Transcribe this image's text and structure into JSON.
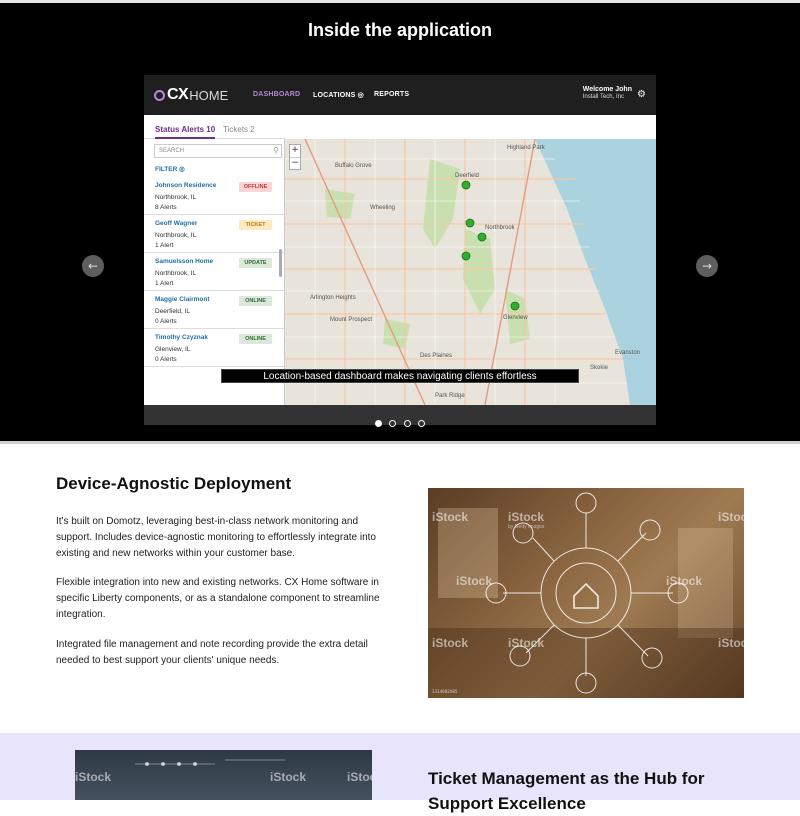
{
  "hero": {
    "title": "Inside the application",
    "caption": "Location-based dashboard makes navigating clients effortless",
    "prev_icon": "arrow-left-icon",
    "next_icon": "arrow-right-icon",
    "slide_count": 4,
    "active_slide": 1
  },
  "app": {
    "logo_cx": "CX",
    "logo_home": "HOME",
    "nav": {
      "dashboard": "DASHBOARD",
      "locations": "LOCATIONS ◎",
      "reports": "REPORTS"
    },
    "user": {
      "welcome": "Welcome John",
      "company": "Install Tech, Inc"
    },
    "tabs": {
      "alerts": "Status Alerts  10",
      "tickets": "Tickets  2"
    },
    "search_placeholder": "SEARCH",
    "filter_label": "FILTER ◎",
    "clients": [
      {
        "name": "Johnson Residence",
        "city": "Northbrook, IL",
        "alerts": "8 Alerts",
        "status": "OFFLINE"
      },
      {
        "name": "Geoff Wagner",
        "city": "Northbrook, IL",
        "alerts": "1 Alert",
        "status": "TICKET"
      },
      {
        "name": "Samuelsson Home",
        "city": "Northbrook, IL",
        "alerts": "1 Alert",
        "status": "UPDATE"
      },
      {
        "name": "Maggie Clairmont",
        "city": "Deerfield, IL",
        "alerts": "0 Alerts",
        "status": "ONLINE"
      },
      {
        "name": "Timothy Czyznak",
        "city": "Glenview, IL",
        "alerts": "0 Alerts",
        "status": "ONLINE"
      }
    ],
    "map": {
      "zoom_in": "+",
      "zoom_out": "−",
      "labels": {
        "highland_park": "Highland Park",
        "buffalo_grove": "Buffalo Grove",
        "northbrook": "Northbrook",
        "glenview": "Glenview",
        "evanston": "Evanston",
        "arlington": "Arlington Heights",
        "mt_prospect": "Mount Prospect",
        "des_plaines": "Des Plaines",
        "skokie": "Skokie",
        "wheeling": "Wheeling",
        "deerfield": "Deerfield",
        "park_ridge": "Park Ridge"
      }
    }
  },
  "feature": {
    "title": "Device-Agnostic Deployment",
    "p1": "It's built on Domotz, leveraging best-in-class network monitoring and support. Includes device-agnostic monitoring to effortlessly integrate into existing and new networks within your customer base.",
    "p2": "Flexible integration into new and existing networks. CX Home software in specific Liberty components, or as a standalone component to streamline integration.",
    "p3": "Integrated file management and note recording provide the extra detail needed to best support your clients' unique needs.",
    "watermark": "iStock",
    "watermark_sub": "by Getty Images",
    "photo_tag": "1314682085"
  },
  "bottom": {
    "title": "Ticket Management as the Hub for Support Excellence",
    "watermark": "iStock"
  }
}
